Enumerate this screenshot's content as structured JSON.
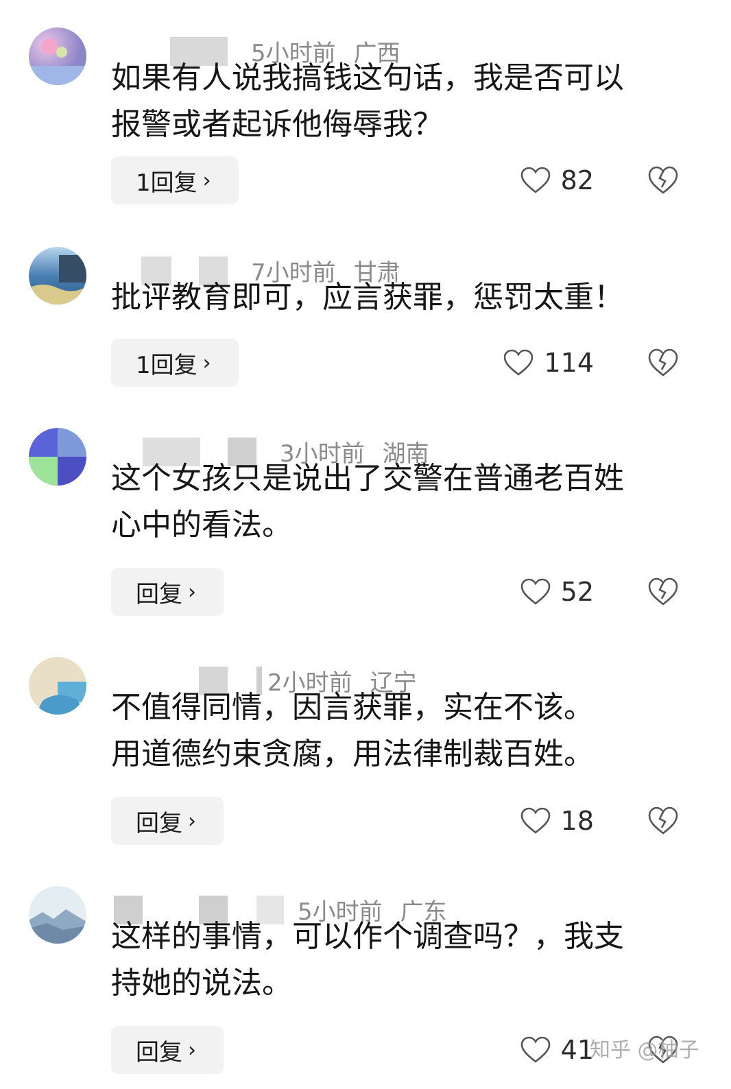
{
  "comments": [
    {
      "time": "5小时前",
      "location": "广西",
      "text_lines": [
        "如果有人说我搞钱这句话，我是否可以",
        "报警或者起诉他侮辱我？"
      ],
      "reply_label": "1回复",
      "likes": "82"
    },
    {
      "time": "7小时前",
      "location": "甘肃",
      "text_lines": [
        "批评教育即可，应言获罪，惩罚太重！"
      ],
      "reply_label": "1回复",
      "likes": "114"
    },
    {
      "time": "3小时前",
      "location": "湖南",
      "text_lines": [
        "这个女孩只是说出了交警在普通老百姓",
        "心中的看法。"
      ],
      "reply_label": "回复",
      "likes": "52"
    },
    {
      "time": "2小时前",
      "location": "辽宁",
      "text_lines": [
        "不值得同情，因言获罪，实在不该。",
        "用道德约束贪腐，用法律制裁百姓。"
      ],
      "reply_label": "回复",
      "likes": "18"
    },
    {
      "time": "5小时前",
      "location": "广东",
      "text_lines": [
        "这样的事情，可以作个调查吗？，我支",
        "持她的说法。"
      ],
      "reply_label": "回复",
      "likes": "41"
    }
  ],
  "chevron": "›",
  "watermark": "知乎 @柚子",
  "icons": {
    "like": "heart-outline-icon",
    "dislike": "broken-heart-icon"
  },
  "colors": {
    "meta": "#8a8a8a",
    "reply_bg": "#f2f2f2",
    "text": "#161616"
  }
}
